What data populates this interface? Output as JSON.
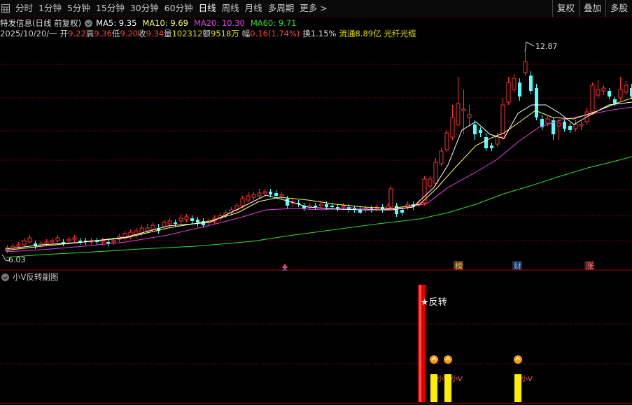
{
  "toolbar": {
    "periods": [
      "分时",
      "1分钟",
      "5分钟",
      "15分钟",
      "30分钟",
      "60分钟",
      "日线",
      "周线",
      "月线",
      "多周期",
      "更多 >"
    ],
    "active": "日线",
    "right_buttons": [
      "复权",
      "叠加",
      "多股"
    ]
  },
  "header": {
    "stock_title": "特发信息(日线 前复权)",
    "ma": [
      {
        "label": "MA5: 9.35",
        "color": "#ffffff"
      },
      {
        "label": "MA10: 9.69",
        "color": "#ffff66"
      },
      {
        "label": "MA20: 10.30",
        "color": "#e040e0"
      },
      {
        "label": "MA60: 9.71",
        "color": "#33dd33"
      }
    ],
    "date": "2025/10/20/一",
    "open_label": "开",
    "open": "9.22",
    "high_label": "高",
    "high": "9.36",
    "low_label": "低",
    "low": "9.20",
    "close_label": "收",
    "close": "9.34",
    "volume_label": "量",
    "volume": "102312",
    "amount_label": "额",
    "amount": "9518万",
    "change_label": "幅",
    "change": "0.16(1.74%)",
    "turnover": "换1.15%",
    "float_cap": "流通8.89亿",
    "concept": "光纤光缆"
  },
  "price_chart": {
    "high_label": "12.87",
    "low_label": "6.03",
    "markers": [
      "榜",
      "财",
      "涨"
    ]
  },
  "sub_chart": {
    "title": "小V反转副图",
    "signal_label": "★反转",
    "small_labels": [
      "小V",
      "小V",
      "小V"
    ]
  },
  "colors": {
    "up": "#ff3030",
    "down": "#54ffff",
    "ma5": "#ffffff",
    "ma10": "#ffff66",
    "ma20": "#e040e0",
    "ma60": "#33dd33",
    "grid": "#7a0000"
  }
}
